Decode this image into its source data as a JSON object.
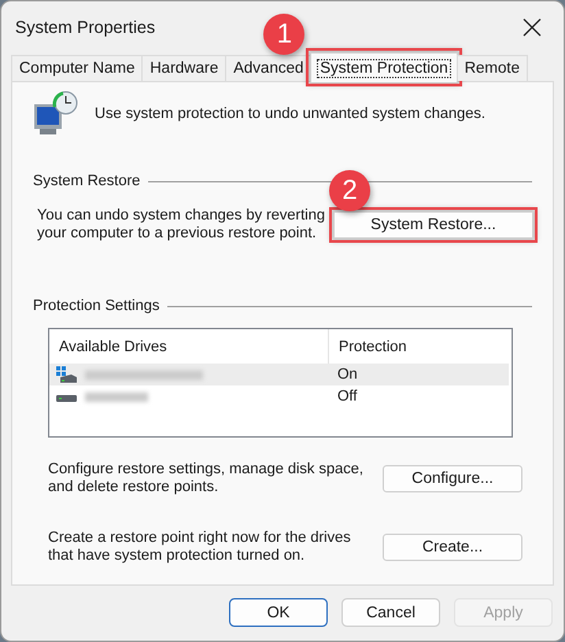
{
  "window": {
    "title": "System Properties"
  },
  "tabs": [
    {
      "label": "Computer Name",
      "selected": false,
      "highlighted": false
    },
    {
      "label": "Hardware",
      "selected": false,
      "highlighted": false
    },
    {
      "label": "Advanced",
      "selected": false,
      "highlighted": false
    },
    {
      "label": "System Protection",
      "selected": true,
      "highlighted": true,
      "callout": "1"
    },
    {
      "label": "Remote",
      "selected": false,
      "highlighted": false
    }
  ],
  "intro": "Use system protection to undo unwanted system changes.",
  "system_restore": {
    "heading": "System Restore",
    "text": "You can undo system changes by reverting your computer to a previous restore point.",
    "button": {
      "label": "System Restore...",
      "highlighted": true,
      "callout": "2"
    }
  },
  "protection_settings": {
    "heading": "Protection Settings",
    "columns": [
      "Available Drives",
      "Protection"
    ],
    "drives": [
      {
        "kind": "system",
        "protection": "On",
        "selected": true
      },
      {
        "kind": "data",
        "protection": "Off",
        "selected": false
      }
    ],
    "actions": [
      {
        "text": "Configure restore settings, manage disk space, and delete restore points.",
        "button": "Configure..."
      },
      {
        "text": "Create a restore point right now for the drives that have system protection turned on.",
        "button": "Create..."
      }
    ]
  },
  "buttons": [
    {
      "label": "OK",
      "default": true,
      "disabled": false
    },
    {
      "label": "Cancel",
      "default": false,
      "disabled": false
    },
    {
      "label": "Apply",
      "default": false,
      "disabled": true
    }
  ]
}
